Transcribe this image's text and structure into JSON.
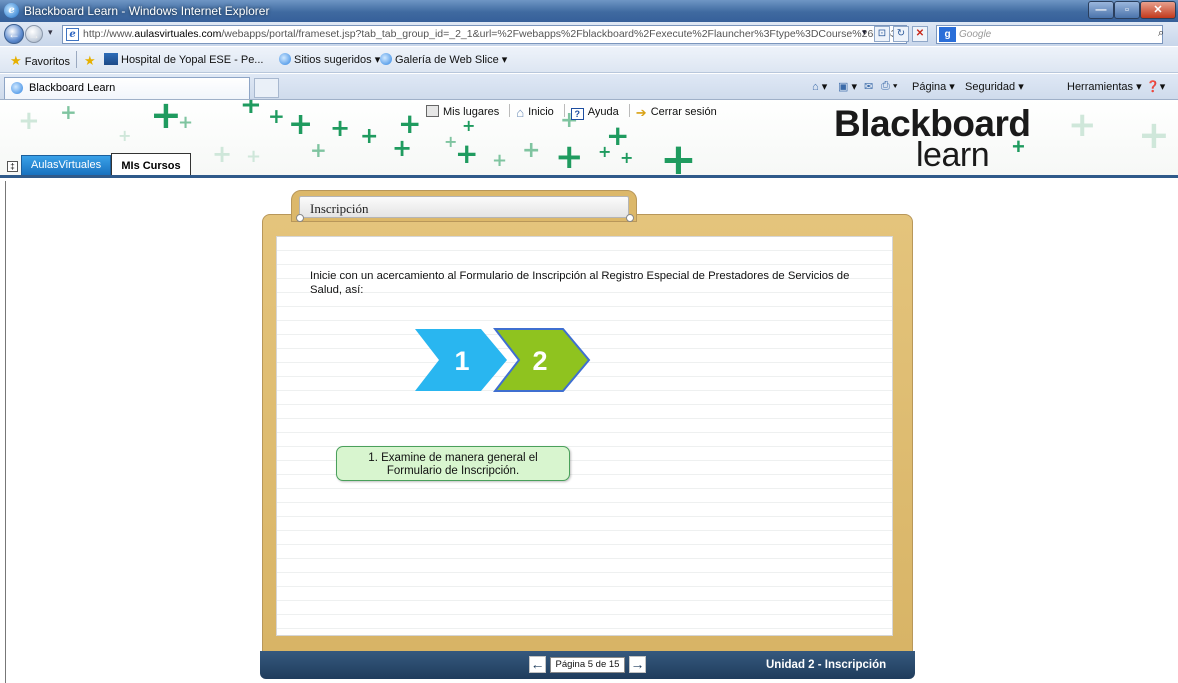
{
  "window": {
    "title": "Blackboard Learn - Windows Internet Explorer"
  },
  "browser": {
    "url_prefix": "http://www.",
    "url_domain": "aulasvirtuales.com",
    "url_rest": "/webapps/portal/frameset.jsp?tab_tab_group_id=_2_1&url=%2Fwebapps%2Fblackboard%2Fexecute%2Flauncher%3Ftype%3DCourse%26id%3D_1",
    "search_placeholder": "Google",
    "favorites_label": "Favoritos",
    "favorites": [
      "Hospital de Yopal ESE - Pe...",
      "Sitios sugeridos ▾",
      "Galería de Web Slice ▾"
    ],
    "active_tab": "Blackboard Learn",
    "commands": {
      "page": "Página ▾",
      "safety": "Seguridad ▾",
      "tools": "Herramientas ▾"
    }
  },
  "bb": {
    "top_links": [
      "Mis lugares",
      "Inicio",
      "Ayuda",
      "Cerrar sesión"
    ],
    "logo_line1": "Blackboard",
    "logo_line2": "learn",
    "tabs": [
      "AulasVirtuales",
      "MIs Cursos"
    ]
  },
  "lesson": {
    "folder_title": "Inscripción",
    "intro_text": "Inicie con un acercamiento al Formulario de Inscripción al Registro Especial de Prestadores de Servicios de Salud, así:",
    "step1": "1",
    "step2": "2",
    "callout_line1": "1. Examine de manera general el",
    "callout_line2": "Formulario de Inscripción.",
    "page_indicator": "Página 5 de 15",
    "unit_label": "Unidad 2 - Inscripción"
  },
  "colors": {
    "step1": "#29b6f0",
    "step2": "#8fc31f",
    "folder": "#dcb86a",
    "bar": "#2b4b6d"
  }
}
